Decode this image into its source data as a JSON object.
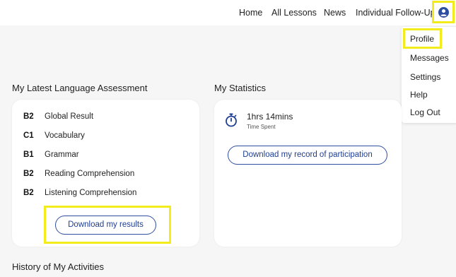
{
  "nav": {
    "items": [
      "Home",
      "All Lessons",
      "News",
      "Individual Follow-Up"
    ]
  },
  "account_menu": {
    "items": [
      "Profile",
      "Messages",
      "Settings",
      "Help",
      "Log Out"
    ]
  },
  "assessment": {
    "title": "My Latest Language Assessment",
    "rows": [
      {
        "level": "B2",
        "skill": "Global Result"
      },
      {
        "level": "C1",
        "skill": "Vocabulary"
      },
      {
        "level": "B1",
        "skill": "Grammar"
      },
      {
        "level": "B2",
        "skill": "Reading Comprehension"
      },
      {
        "level": "B2",
        "skill": "Listening Comprehension"
      }
    ],
    "download_label": "Download my results"
  },
  "statistics": {
    "title": "My Statistics",
    "time_value": "1hrs 14mins",
    "time_label": "Time Spent",
    "download_label": "Download my record of participation"
  },
  "history": {
    "title": "History of My Activities"
  },
  "colors": {
    "accent_blue": "#1f3e93",
    "highlight_yellow": "#f2ec1c"
  },
  "icons": {
    "account": "user-circle-icon",
    "timer": "stopwatch-icon"
  }
}
